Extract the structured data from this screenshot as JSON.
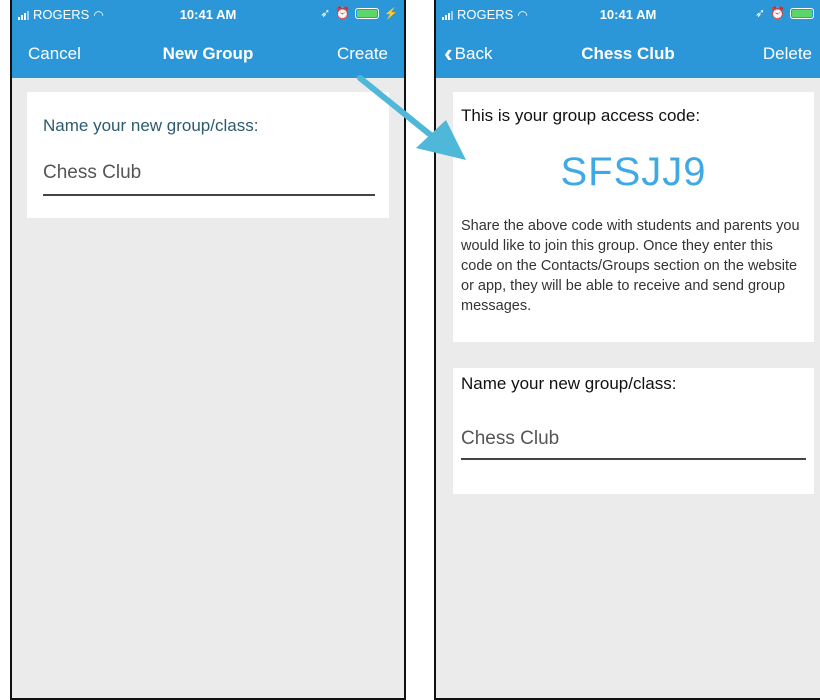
{
  "colors": {
    "nav_blue": "#2b97d8",
    "code_blue": "#3fa9e6",
    "arrow": "#4fb8d8",
    "label_dark": "#2d5a70"
  },
  "left_screen": {
    "status": {
      "carrier": "ROGERS",
      "time": "10:41 AM"
    },
    "nav": {
      "left": "Cancel",
      "title": "New Group",
      "right": "Create"
    },
    "form": {
      "label": "Name your new group/class:",
      "value": "Chess Club"
    }
  },
  "right_screen": {
    "status": {
      "carrier": "ROGERS",
      "time": "10:41 AM"
    },
    "nav": {
      "left": "Back",
      "title": "Chess Club",
      "right": "Delete"
    },
    "access": {
      "heading": "This is your group access code:",
      "code": "SFSJJ9",
      "description": "Share the above code with students and parents you would like to join this group. Once they enter this code on the Contacts/Groups section on the website or app, they will be able to receive and send group messages."
    },
    "form": {
      "label": "Name your new group/class:",
      "value": "Chess Club"
    }
  },
  "icons": {
    "signal": "signal-bars-icon",
    "wifi": "wifi-icon",
    "location": "location-arrow-icon",
    "alarm": "alarm-clock-icon",
    "battery": "battery-icon",
    "back": "chevron-left-icon",
    "arrow": "pointer-arrow-icon"
  }
}
